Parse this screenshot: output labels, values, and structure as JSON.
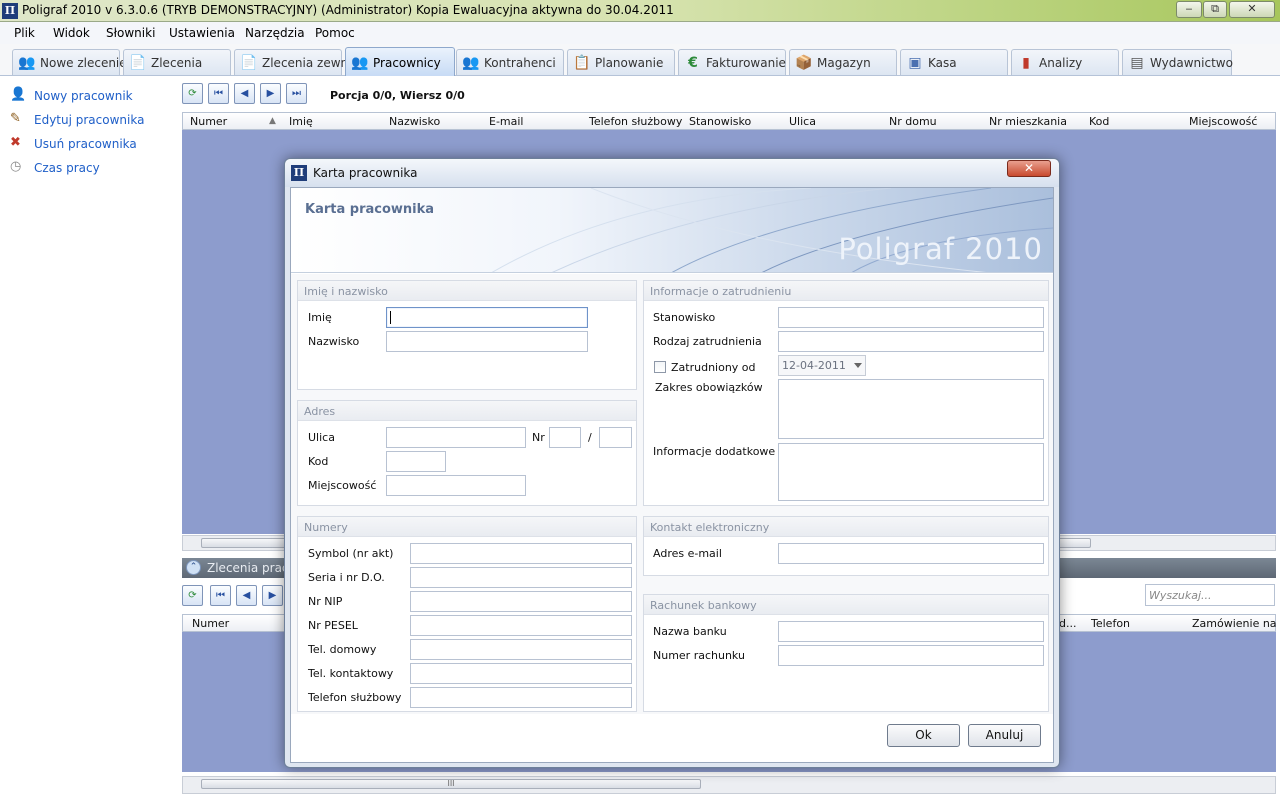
{
  "window": {
    "app_icon": "Π",
    "title": "Poligraf 2010 v 6.3.0.6 (TRYB DEMONSTRACYJNY) (Administrator) Kopia Ewaluacyjna aktywna do 30.04.2011",
    "minimize": "‒",
    "maximize": "⧉",
    "close": "✕"
  },
  "menu": [
    "Plik",
    "Widok",
    "Słowniki",
    "Ustawienia",
    "Narzędzia",
    "Pomoc"
  ],
  "tabs": [
    {
      "label": "Nowe zlecenie",
      "icon": "👥"
    },
    {
      "label": "Zlecenia",
      "icon": "📄"
    },
    {
      "label": "Zlecenia zewn.",
      "icon": "📄"
    },
    {
      "label": "Pracownicy",
      "icon": "👥",
      "active": true
    },
    {
      "label": "Kontrahenci",
      "icon": "👥"
    },
    {
      "label": "Planowanie",
      "icon": "📋"
    },
    {
      "label": "Fakturowanie",
      "icon": "€"
    },
    {
      "label": "Magazyn",
      "icon": "📦"
    },
    {
      "label": "Kasa",
      "icon": "▣"
    },
    {
      "label": "Analizy",
      "icon": "▮"
    },
    {
      "label": "Wydawnictwo",
      "icon": "▤"
    }
  ],
  "sidebar": {
    "items": [
      {
        "label": "Nowy pracownik",
        "icon": "👤"
      },
      {
        "label": "Edytuj pracownika",
        "icon": "✎"
      },
      {
        "label": "Usuń pracownika",
        "icon": "✖"
      },
      {
        "label": "Czas pracy",
        "icon": "◷"
      }
    ]
  },
  "grid": {
    "porcja": "Porcja 0/0, Wiersz 0/0",
    "columns": [
      "Numer",
      "Imię",
      "Nazwisko",
      "E-mail",
      "Telefon służbowy",
      "Stanowisko",
      "Ulica",
      "Nr domu",
      "Nr mieszkania",
      "Kod",
      "Miejscowość"
    ],
    "sort_indicator": "▲"
  },
  "lower": {
    "title": "Zlecenia praco",
    "search_placeholder": "Wyszukaj...",
    "columns_left": [
      "Numer"
    ],
    "columns_right": [
      "d...",
      "Telefon",
      "Zamówienie na"
    ]
  },
  "toolbar_icons": {
    "refresh": "⟳",
    "first": "⏮",
    "prev": "◀",
    "next": "▶",
    "last": "⏭",
    "collapse": "⌃",
    "scroll_mark": "III"
  },
  "dialog": {
    "icon": "Π",
    "title": "Karta pracownika",
    "close": "✕",
    "banner_title": "Karta pracownika",
    "banner_logo": "Poligraf 2010",
    "groups": {
      "name": {
        "header": "Imię i nazwisko",
        "imie": "Imię",
        "nazwisko": "Nazwisko",
        "imie_value": "",
        "nazwisko_value": ""
      },
      "address": {
        "header": "Adres",
        "ulica": "Ulica",
        "nr": "Nr",
        "slash": "/",
        "kod": "Kod",
        "miejscowosc": "Miejscowość"
      },
      "numbers": {
        "header": "Numery",
        "labels": [
          "Symbol (nr akt)",
          "Seria i nr D.O.",
          "Nr NIP",
          "Nr PESEL",
          "Tel. domowy",
          "Tel. kontaktowy",
          "Telefon służbowy"
        ]
      },
      "employment": {
        "header": "Informacje o zatrudnieniu",
        "stanowisko": "Stanowisko",
        "rodzaj": "Rodzaj zatrudnienia",
        "zatrudniony_od": "Zatrudniony od",
        "zatrudniony_checked": false,
        "date_value": "12-04-2011",
        "zakres": "Zakres obowiązków",
        "info": "Informacje dodatkowe"
      },
      "contact": {
        "header": "Kontakt elektroniczny",
        "email": "Adres e-mail"
      },
      "bank": {
        "header": "Rachunek bankowy",
        "nazwa": "Nazwa banku",
        "numer": "Numer rachunku"
      }
    },
    "ok": "Ok",
    "cancel": "Anuluj"
  }
}
